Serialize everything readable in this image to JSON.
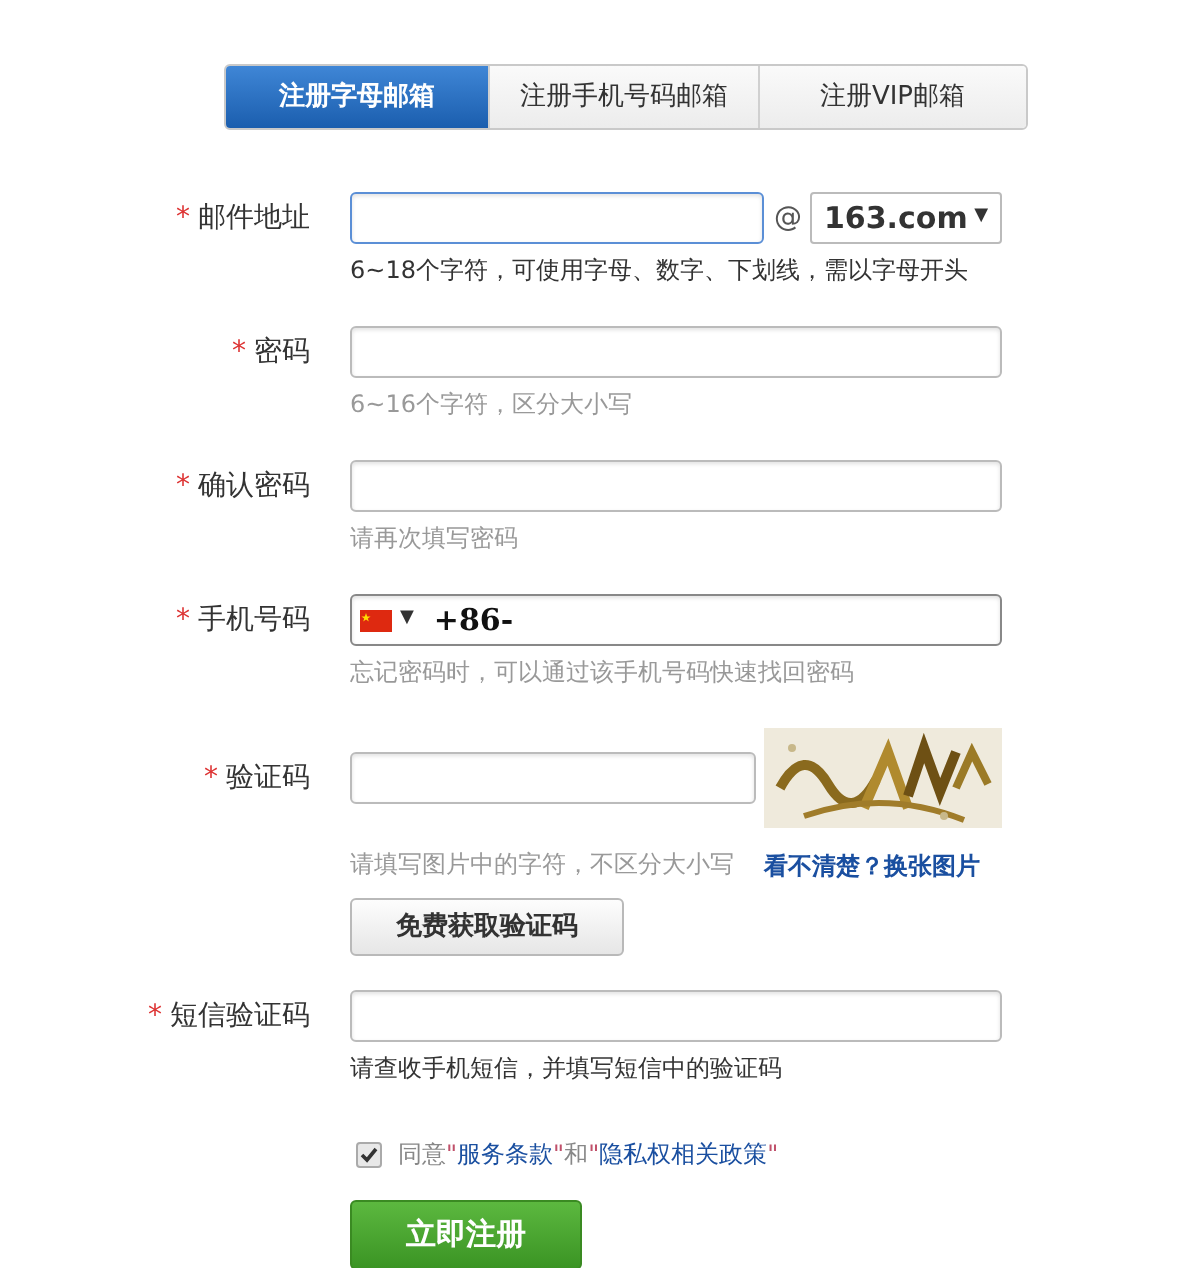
{
  "tabs": [
    {
      "label": "注册字母邮箱",
      "selected": true
    },
    {
      "label": "注册手机号码邮箱",
      "selected": false
    },
    {
      "label": "注册VIP邮箱",
      "selected": false
    }
  ],
  "fields": [
    {
      "kind": "email",
      "mark": "*",
      "label": "邮件地址",
      "at": "@",
      "domain": "163.com",
      "caret": "▼",
      "hint": "6~18个字符，可使用字母、数字、下划线，需以字母开头",
      "hint_dark": true,
      "focused": true
    },
    {
      "kind": "text",
      "mark": "*",
      "label": "密码",
      "hint": "6~16个字符，区分大小写",
      "hint_dark": false,
      "focused": false
    },
    {
      "kind": "text",
      "mark": "*",
      "label": "确认密码",
      "hint": "请再次填写密码",
      "hint_dark": false,
      "focused": false
    },
    {
      "kind": "phone",
      "mark": "*",
      "label": "手机号码",
      "caret": "▼",
      "value": "+86-",
      "hint": "忘记密码时，可以通过该手机号码快速找回密码",
      "hint_dark": false,
      "focused": false
    },
    {
      "kind": "captcha",
      "mark": "*",
      "label": "验证码",
      "hint": "请填写图片中的字符，不区分大小写",
      "hint_dark": false,
      "focused": false,
      "refresh_link": "看不清楚？换张图片",
      "button": "免费获取验证码"
    },
    {
      "kind": "text",
      "mark": "*",
      "label": "短信验证码",
      "hint": "请查收手机短信，并填写短信中的验证码",
      "hint_dark": true,
      "focused": false
    }
  ],
  "agreement": {
    "checked": true,
    "parts": [
      {
        "kind": "text",
        "text": "同意\""
      },
      {
        "kind": "link",
        "text": "服务条款"
      },
      {
        "kind": "text",
        "text": "\"和\""
      },
      {
        "kind": "link",
        "text": "隐私权相关政策"
      },
      {
        "kind": "text",
        "text": "\""
      }
    ]
  },
  "submit": "立即注册"
}
